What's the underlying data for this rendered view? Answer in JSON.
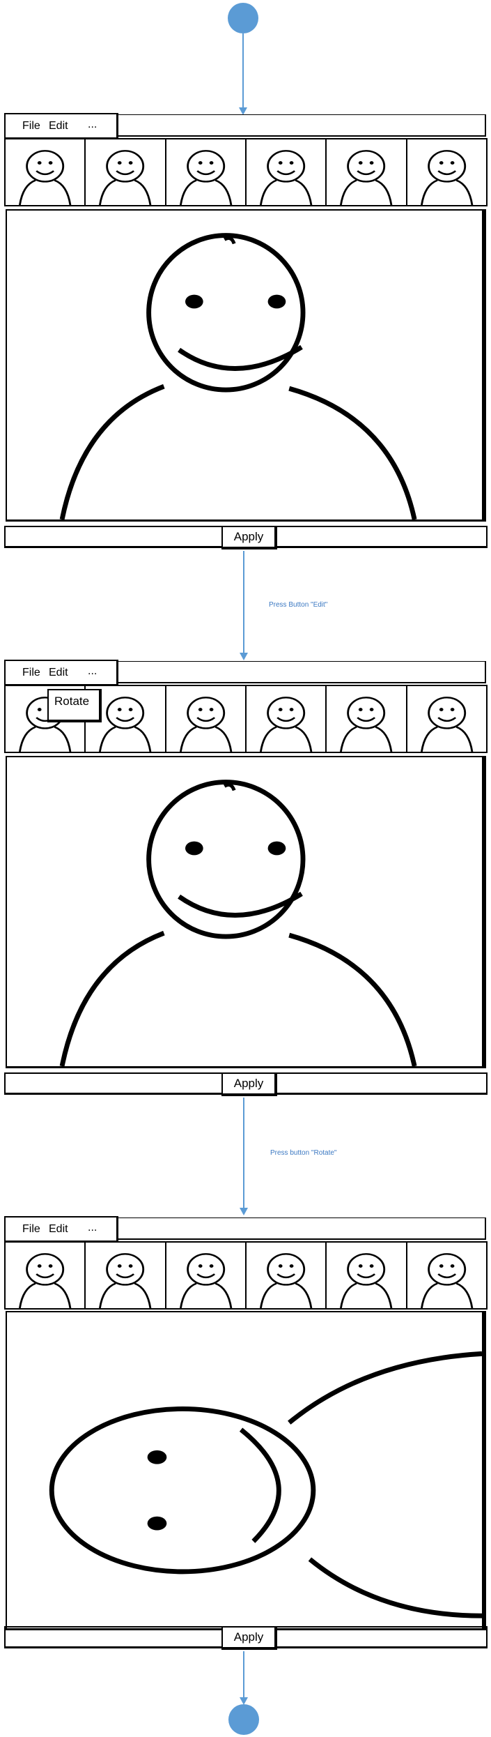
{
  "frames": [
    {
      "menu": {
        "file": "File",
        "edit": "Edit",
        "more": "..."
      },
      "apply_label": "Apply",
      "thumbnail_count": 6,
      "main_image": "person-upright"
    },
    {
      "menu": {
        "file": "File",
        "edit": "Edit",
        "more": "..."
      },
      "popup_label": "Rotate",
      "apply_label": "Apply",
      "thumbnail_count": 6,
      "main_image": "person-upright"
    },
    {
      "menu": {
        "file": "File",
        "edit": "Edit",
        "more": "..."
      },
      "apply_label": "Apply",
      "thumbnail_count": 6,
      "main_image": "person-rotated"
    }
  ],
  "edges": [
    {
      "label": "Press Button \"Edit\""
    },
    {
      "label": "Press button \"Rotate\""
    }
  ],
  "colors": {
    "flow": "#5b9bd5",
    "label": "#3b78c2",
    "ink": "#000000"
  }
}
